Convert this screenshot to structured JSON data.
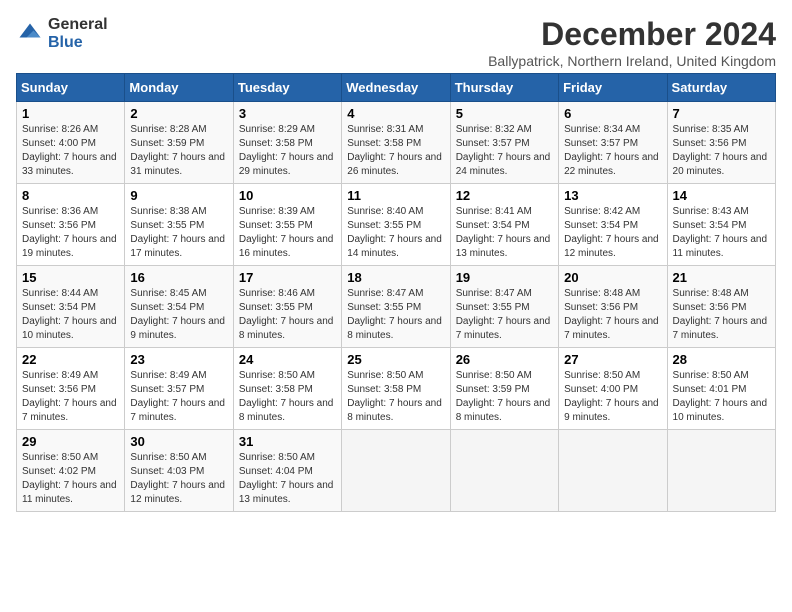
{
  "logo": {
    "line1": "General",
    "line2": "Blue"
  },
  "title": "December 2024",
  "subtitle": "Ballypatrick, Northern Ireland, United Kingdom",
  "headers": [
    "Sunday",
    "Monday",
    "Tuesday",
    "Wednesday",
    "Thursday",
    "Friday",
    "Saturday"
  ],
  "weeks": [
    [
      {
        "day": "1",
        "sunrise": "8:26 AM",
        "sunset": "4:00 PM",
        "daylight": "7 hours and 33 minutes."
      },
      {
        "day": "2",
        "sunrise": "8:28 AM",
        "sunset": "3:59 PM",
        "daylight": "7 hours and 31 minutes."
      },
      {
        "day": "3",
        "sunrise": "8:29 AM",
        "sunset": "3:58 PM",
        "daylight": "7 hours and 29 minutes."
      },
      {
        "day": "4",
        "sunrise": "8:31 AM",
        "sunset": "3:58 PM",
        "daylight": "7 hours and 26 minutes."
      },
      {
        "day": "5",
        "sunrise": "8:32 AM",
        "sunset": "3:57 PM",
        "daylight": "7 hours and 24 minutes."
      },
      {
        "day": "6",
        "sunrise": "8:34 AM",
        "sunset": "3:57 PM",
        "daylight": "7 hours and 22 minutes."
      },
      {
        "day": "7",
        "sunrise": "8:35 AM",
        "sunset": "3:56 PM",
        "daylight": "7 hours and 20 minutes."
      }
    ],
    [
      {
        "day": "8",
        "sunrise": "8:36 AM",
        "sunset": "3:56 PM",
        "daylight": "7 hours and 19 minutes."
      },
      {
        "day": "9",
        "sunrise": "8:38 AM",
        "sunset": "3:55 PM",
        "daylight": "7 hours and 17 minutes."
      },
      {
        "day": "10",
        "sunrise": "8:39 AM",
        "sunset": "3:55 PM",
        "daylight": "7 hours and 16 minutes."
      },
      {
        "day": "11",
        "sunrise": "8:40 AM",
        "sunset": "3:55 PM",
        "daylight": "7 hours and 14 minutes."
      },
      {
        "day": "12",
        "sunrise": "8:41 AM",
        "sunset": "3:54 PM",
        "daylight": "7 hours and 13 minutes."
      },
      {
        "day": "13",
        "sunrise": "8:42 AM",
        "sunset": "3:54 PM",
        "daylight": "7 hours and 12 minutes."
      },
      {
        "day": "14",
        "sunrise": "8:43 AM",
        "sunset": "3:54 PM",
        "daylight": "7 hours and 11 minutes."
      }
    ],
    [
      {
        "day": "15",
        "sunrise": "8:44 AM",
        "sunset": "3:54 PM",
        "daylight": "7 hours and 10 minutes."
      },
      {
        "day": "16",
        "sunrise": "8:45 AM",
        "sunset": "3:54 PM",
        "daylight": "7 hours and 9 minutes."
      },
      {
        "day": "17",
        "sunrise": "8:46 AM",
        "sunset": "3:55 PM",
        "daylight": "7 hours and 8 minutes."
      },
      {
        "day": "18",
        "sunrise": "8:47 AM",
        "sunset": "3:55 PM",
        "daylight": "7 hours and 8 minutes."
      },
      {
        "day": "19",
        "sunrise": "8:47 AM",
        "sunset": "3:55 PM",
        "daylight": "7 hours and 7 minutes."
      },
      {
        "day": "20",
        "sunrise": "8:48 AM",
        "sunset": "3:56 PM",
        "daylight": "7 hours and 7 minutes."
      },
      {
        "day": "21",
        "sunrise": "8:48 AM",
        "sunset": "3:56 PM",
        "daylight": "7 hours and 7 minutes."
      }
    ],
    [
      {
        "day": "22",
        "sunrise": "8:49 AM",
        "sunset": "3:56 PM",
        "daylight": "7 hours and 7 minutes."
      },
      {
        "day": "23",
        "sunrise": "8:49 AM",
        "sunset": "3:57 PM",
        "daylight": "7 hours and 7 minutes."
      },
      {
        "day": "24",
        "sunrise": "8:50 AM",
        "sunset": "3:58 PM",
        "daylight": "7 hours and 8 minutes."
      },
      {
        "day": "25",
        "sunrise": "8:50 AM",
        "sunset": "3:58 PM",
        "daylight": "7 hours and 8 minutes."
      },
      {
        "day": "26",
        "sunrise": "8:50 AM",
        "sunset": "3:59 PM",
        "daylight": "7 hours and 8 minutes."
      },
      {
        "day": "27",
        "sunrise": "8:50 AM",
        "sunset": "4:00 PM",
        "daylight": "7 hours and 9 minutes."
      },
      {
        "day": "28",
        "sunrise": "8:50 AM",
        "sunset": "4:01 PM",
        "daylight": "7 hours and 10 minutes."
      }
    ],
    [
      {
        "day": "29",
        "sunrise": "8:50 AM",
        "sunset": "4:02 PM",
        "daylight": "7 hours and 11 minutes."
      },
      {
        "day": "30",
        "sunrise": "8:50 AM",
        "sunset": "4:03 PM",
        "daylight": "7 hours and 12 minutes."
      },
      {
        "day": "31",
        "sunrise": "8:50 AM",
        "sunset": "4:04 PM",
        "daylight": "7 hours and 13 minutes."
      },
      null,
      null,
      null,
      null
    ]
  ]
}
